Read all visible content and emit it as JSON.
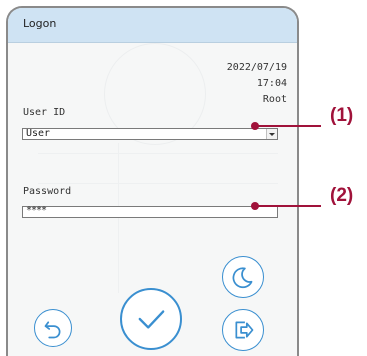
{
  "window": {
    "title": "Logon"
  },
  "info": {
    "date": "2022/07/19",
    "time": "17:04",
    "user": "Root"
  },
  "user_id": {
    "label": "User ID",
    "selected": "User"
  },
  "password": {
    "label": "Password",
    "value": "****"
  },
  "buttons": {
    "sleep": {
      "icon": "moon-icon"
    },
    "back": {
      "icon": "undo-icon"
    },
    "confirm": {
      "icon": "checkmark-icon"
    },
    "logout": {
      "icon": "logout-icon"
    }
  },
  "callouts": {
    "one": "(1)",
    "two": "(2)"
  },
  "colors": {
    "accent": "#3a8fd0",
    "titlebar": "#cfe3f3",
    "callout": "#a0123a"
  }
}
